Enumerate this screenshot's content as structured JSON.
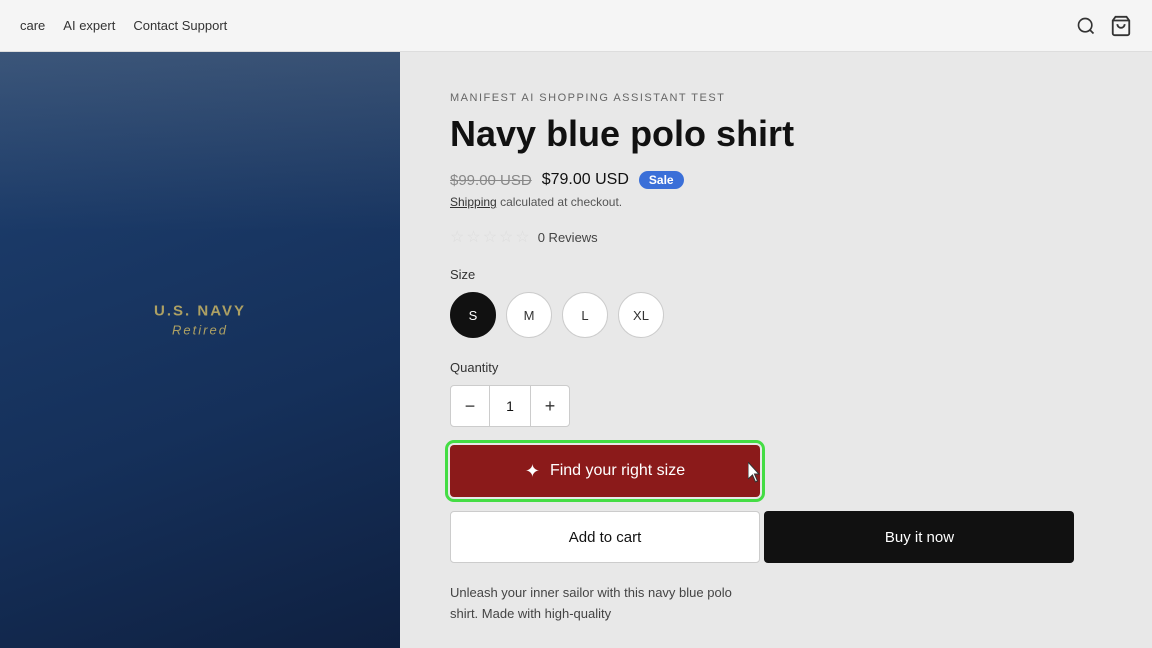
{
  "navbar": {
    "items": [
      {
        "id": "care",
        "label": "care"
      },
      {
        "id": "ai-expert",
        "label": "AI expert"
      },
      {
        "id": "contact-support",
        "label": "Contact Support"
      }
    ]
  },
  "product": {
    "brand": "MANIFEST AI SHOPPING ASSISTANT TEST",
    "title": "Navy blue polo shirt",
    "original_price": "$99.00 USD",
    "sale_price": "$79.00 USD",
    "sale_badge": "Sale",
    "shipping_text": "Shipping calculated at checkout.",
    "shipping_label": "Shipping",
    "reviews_count": "0 Reviews",
    "size_label": "Size",
    "sizes": [
      "S",
      "M",
      "L",
      "XL"
    ],
    "selected_size": "S",
    "quantity_label": "Quantity",
    "quantity_value": "1",
    "find_size_label": "Find your right size",
    "add_to_cart_label": "Add to cart",
    "buy_now_label": "Buy it now",
    "description": "Unleash your inner sailor with this navy blue polo shirt. Made with high-quality",
    "shirt_text_line1": "U.S. NAVY",
    "shirt_text_line2": "Retired"
  }
}
